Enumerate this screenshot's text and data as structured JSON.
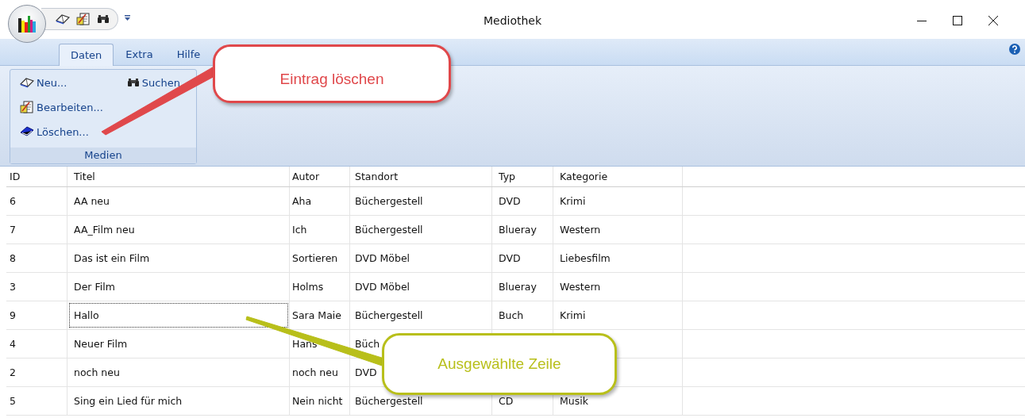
{
  "window": {
    "title": "Mediothek"
  },
  "quick_access": [
    {
      "kind": "book"
    },
    {
      "kind": "edit"
    },
    {
      "kind": "binoculars"
    }
  ],
  "tabs": [
    {
      "label": "Daten",
      "selected": true
    },
    {
      "label": "Extra",
      "selected": false
    },
    {
      "label": "Hilfe",
      "selected": false
    }
  ],
  "ribbon": {
    "group": "Medien",
    "commands": [
      {
        "label": "Neu...",
        "kind": "book"
      },
      {
        "label": "Bearbeiten...",
        "kind": "edit"
      },
      {
        "label": "Löschen...",
        "kind": "delete"
      },
      {
        "label": "Suchen",
        "kind": "binoculars"
      }
    ]
  },
  "table": {
    "columns": [
      "ID",
      "Titel",
      "Autor",
      "Standort",
      "Typ",
      "Kategorie"
    ],
    "rows": [
      {
        "cells": [
          "6",
          "AA neu",
          "Aha",
          "Büchergestell",
          "DVD",
          "Krimi"
        ],
        "selected": false
      },
      {
        "cells": [
          "7",
          "AA_Film neu",
          "Ich",
          "Büchergestell",
          "Blueray",
          "Western"
        ],
        "selected": false
      },
      {
        "cells": [
          "8",
          "Das ist ein Film",
          "Sortieren",
          "DVD Möbel",
          "DVD",
          "Liebesfilm"
        ],
        "selected": false
      },
      {
        "cells": [
          "3",
          "Der Film",
          "Holms",
          "DVD Möbel",
          "Blueray",
          "Western"
        ],
        "selected": false
      },
      {
        "cells": [
          "9",
          "Hallo",
          "Sara Maie",
          "Büchergestell",
          "Buch",
          "Krimi"
        ],
        "selected": true
      },
      {
        "cells": [
          "4",
          "Neuer Film",
          "Hans",
          "Büch"
        ],
        "selected": false
      },
      {
        "cells": [
          "2",
          "noch neu",
          "noch neu",
          "DVD"
        ],
        "selected": false
      },
      {
        "cells": [
          "5",
          "Sing ein Lied für mich",
          "Nein nicht",
          "Büchergestell",
          "CD",
          "Musik"
        ],
        "selected": false
      }
    ]
  },
  "callouts": [
    {
      "text": "Eintrag löschen",
      "color": "#e0484b"
    },
    {
      "text": "Ausgewählte Zeile",
      "color": "#b8bf1a"
    }
  ]
}
